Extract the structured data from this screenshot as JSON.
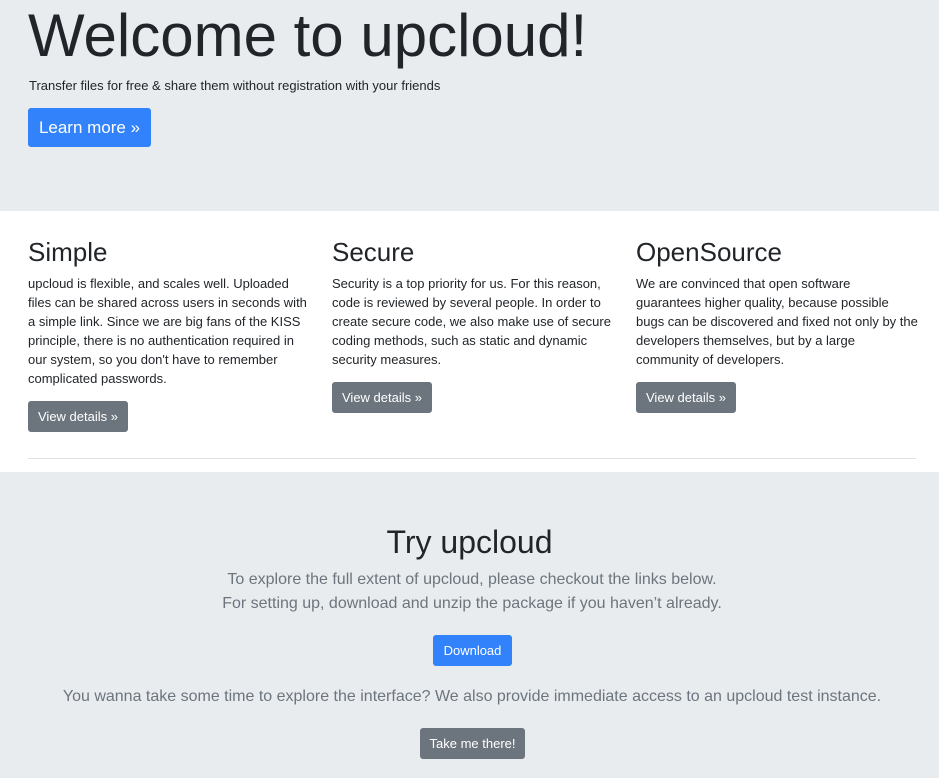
{
  "hero": {
    "title": "Welcome to upcloud!",
    "lead": "Transfer files for free & share them without registration with your friends",
    "learn_more_label": "Learn more »"
  },
  "features": [
    {
      "title": "Simple",
      "text": "upcloud is flexible, and scales well. Uploaded files can be shared across users in seconds with a simple link. Since we are big fans of the KISS principle, there is no authentication required in our system, so you don't have to remember complicated passwords.",
      "button_label": "View details »"
    },
    {
      "title": "Secure",
      "text": "Security is a top priority for us. For this reason, code is reviewed by several people. In order to create secure code, we also make use of secure coding methods, such as static and dynamic security measures.",
      "button_label": "View details »"
    },
    {
      "title": "OpenSource",
      "text": "We are convinced that open software guarantees higher quality, because possible bugs can be discovered and fixed not only by the developers themselves, but by a large community of developers.",
      "button_label": "View details »"
    }
  ],
  "try": {
    "title": "Try upcloud",
    "line1": "To explore the full extent of upcloud, please checkout the links below.",
    "line2": "For setting up, download and unzip the package if you haven’t already.",
    "download_label": "Download",
    "explore_text": "You wanna take some time to explore the interface? We also provide immediate access to an upcloud test instance.",
    "take_me_label": "Take me there!"
  },
  "colors": {
    "page_background": "#e9ecef",
    "section_background": "#ffffff",
    "primary": "#3182fb",
    "secondary": "#6c757d",
    "text": "#212529",
    "muted_text": "#6c757d"
  }
}
